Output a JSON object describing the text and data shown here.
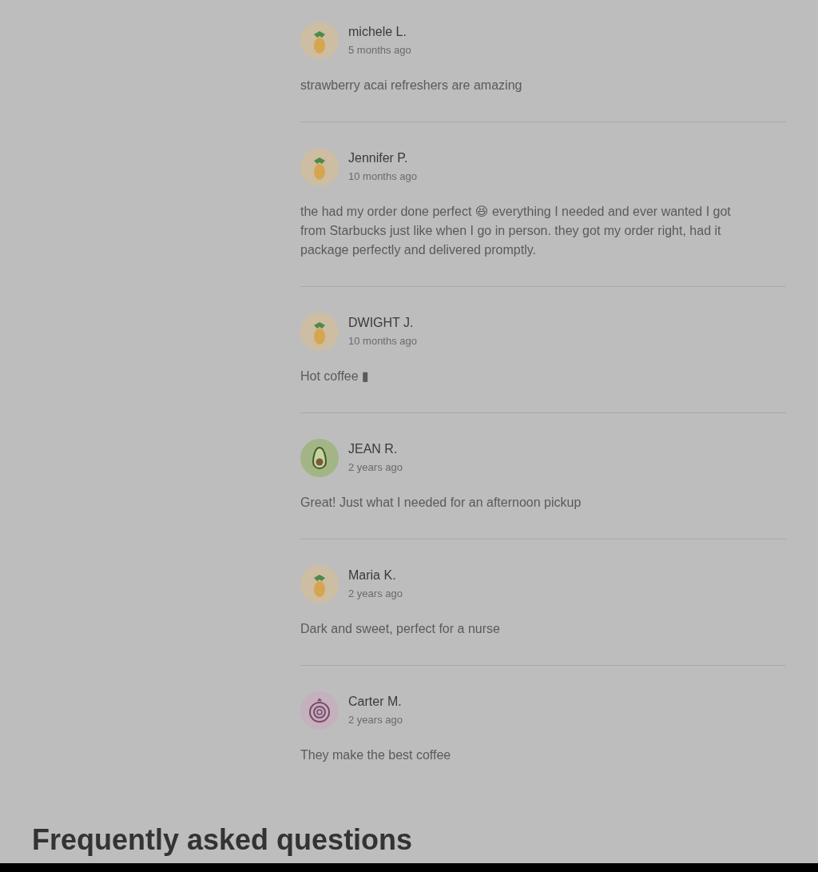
{
  "reviews": [
    {
      "name": "michele L.",
      "time": "5 months ago",
      "text": "strawberry acai refreshers are amazing",
      "avatar": {
        "kind": "pineapple"
      }
    },
    {
      "name": "Jennifer P.",
      "time": "10 months ago",
      "text": "the had my order done perfect 😆 everything I needed and ever wanted I got from Starbucks just like when I go in person. they got my order right, had it package perfectly and delivered promptly.",
      "avatar": {
        "kind": "pineapple"
      }
    },
    {
      "name": "DWIGHT J.",
      "time": "10 months ago",
      "text": "Hot coffee ▮",
      "avatar": {
        "kind": "pineapple"
      }
    },
    {
      "name": "JEAN R.",
      "time": "2 years ago",
      "text": "Great! Just what I needed for an afternoon pickup",
      "avatar": {
        "kind": "avocado"
      }
    },
    {
      "name": "Maria K.",
      "time": "2 years ago",
      "text": "Dark and sweet, perfect for a nurse",
      "avatar": {
        "kind": "pineapple"
      }
    },
    {
      "name": "Carter M.",
      "time": "2 years ago",
      "text": "They make the best coffee",
      "avatar": {
        "kind": "onion"
      }
    }
  ],
  "faq": {
    "heading": "Frequently asked questions"
  }
}
